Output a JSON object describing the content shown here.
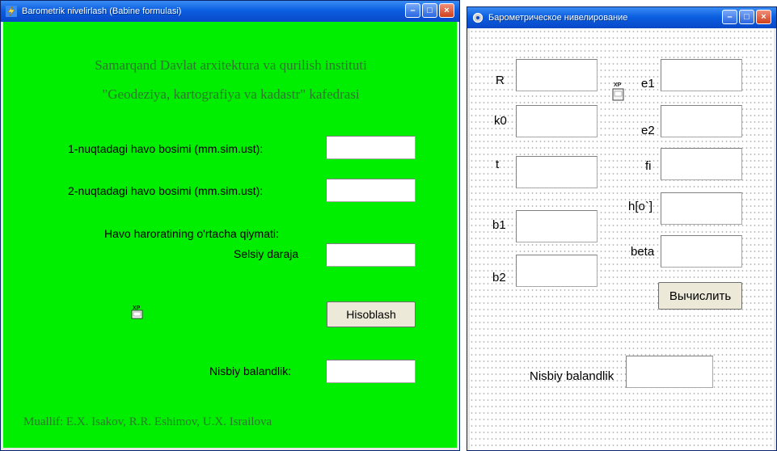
{
  "left_window": {
    "title": "Barometrik nivelirlash (Babine formulasi)",
    "header_line1": "Samarqand Davlat arxitektura va qurilish instituti",
    "header_line2": "\"Geodeziya, kartografiya va kadastr\" kafedrasi",
    "pressure1_label": "1-nuqtadagi havo bosimi (mm.sim.ust):",
    "pressure2_label": "2-nuqtadagi havo bosimi (mm.sim.ust):",
    "temp_label": "Havo haroratining o'rtacha qiymati:",
    "celsius_label": "Selsiy daraja",
    "calculate_button": "Hisoblash",
    "relative_height_label": "Nisbiy balandlik:",
    "author": "Muallif: E.X. Isakov, R.R. Eshimov, U.X. Israilova",
    "pressure1_value": "",
    "pressure2_value": "",
    "celsius_value": "",
    "relative_height_value": "",
    "small_icon_text": "XP"
  },
  "right_window": {
    "title": "Барометрическое нивелирование",
    "label_R": "R",
    "label_k0": "k0",
    "label_t": "t",
    "label_b1": "b1",
    "label_b2": "b2",
    "label_e1": "e1",
    "label_e2": "e2",
    "label_fi": "fi",
    "label_h": "h[o`]",
    "label_beta": "beta",
    "calculate_button": "Вычислить",
    "relative_height_label": "Nisbiy balandlik",
    "small_icon_text": "XP"
  },
  "icons": {
    "app_icon_left": "lightning-app-icon",
    "app_icon_right": "gear-app-icon",
    "window_controls": [
      "minimize-icon",
      "maximize-icon",
      "close-icon"
    ],
    "xp_icon": "xp-component-icon"
  },
  "colors": {
    "left_background": "#00ee00",
    "titlebar": "#0c5fe0"
  }
}
